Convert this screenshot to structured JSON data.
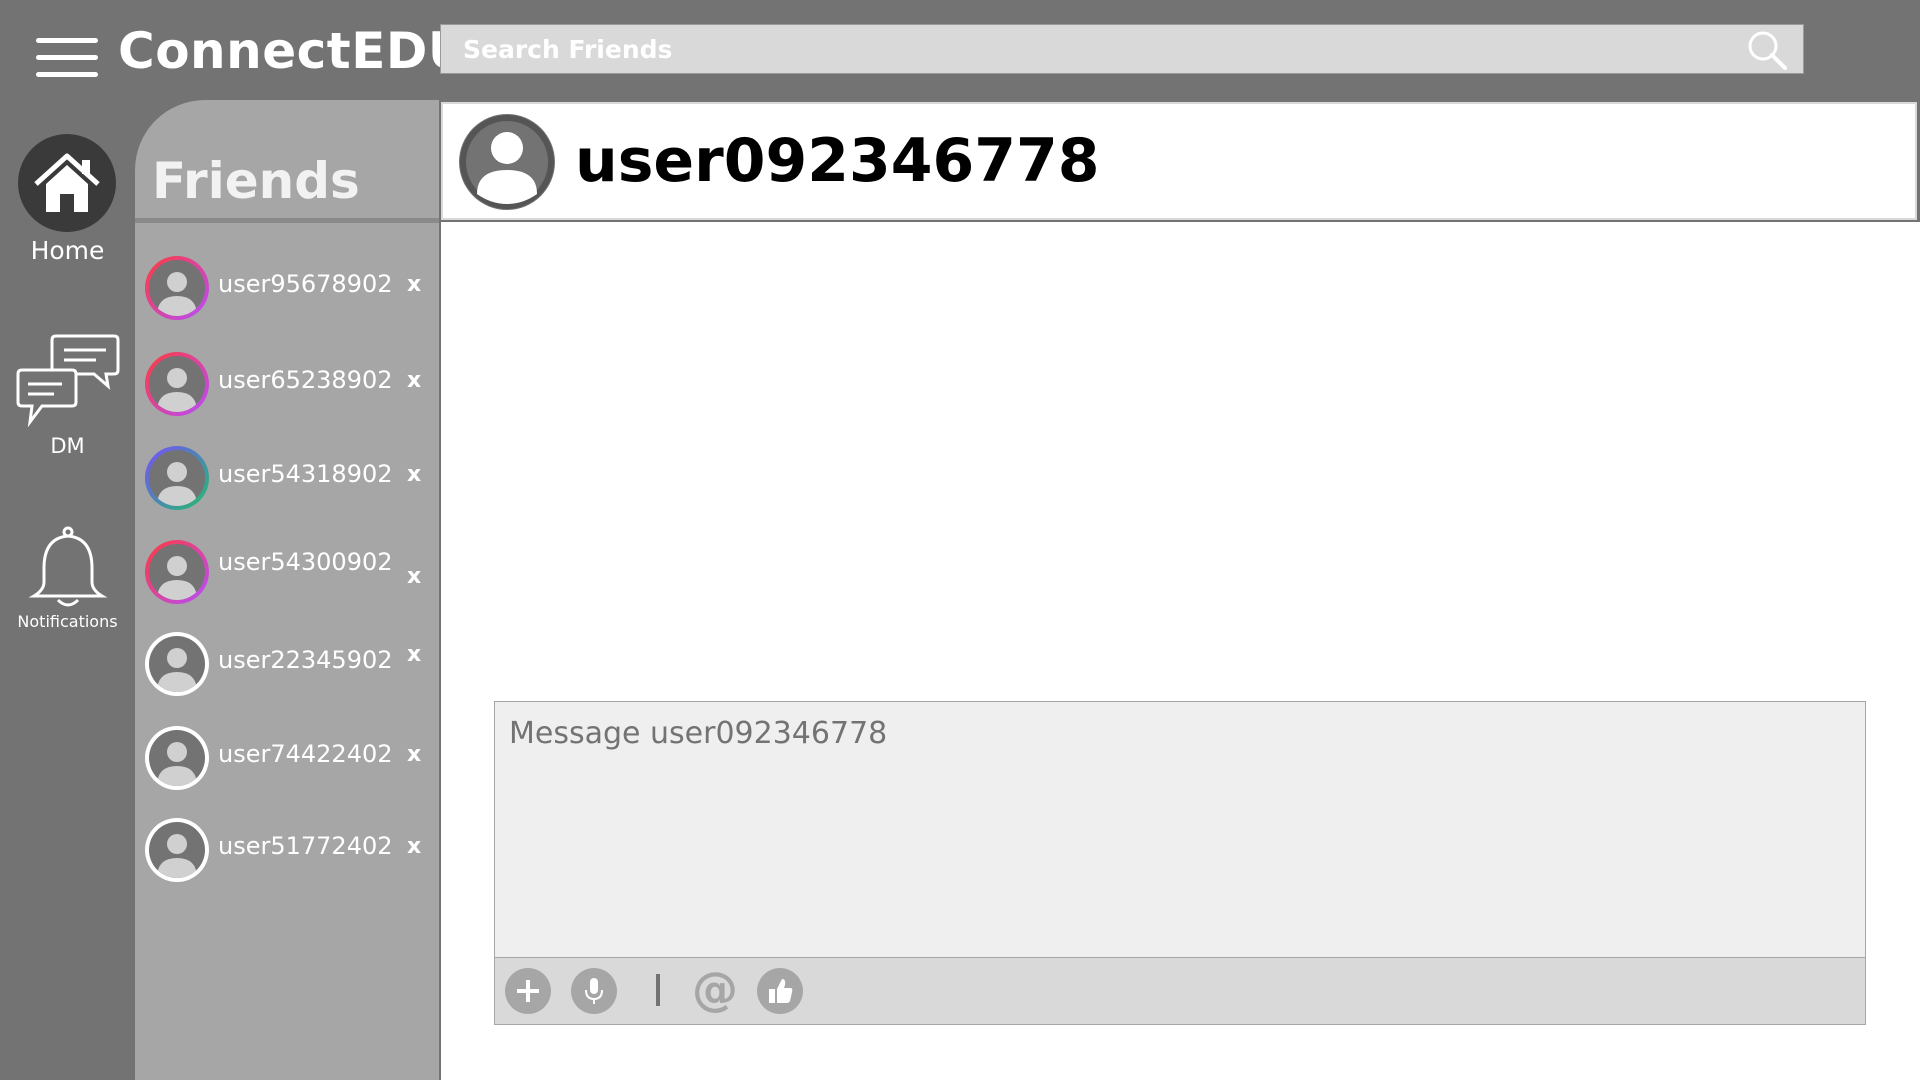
{
  "app": {
    "title": "ConnectEDU"
  },
  "search": {
    "placeholder": "Search Friends"
  },
  "nav": {
    "home_label": "Home",
    "dm_label": "DM",
    "notifications_label": "Notifications"
  },
  "friends": {
    "title": "Friends",
    "remove_label": "x",
    "items": [
      {
        "name": "user95678902",
        "ring": "gradient-pink-purple"
      },
      {
        "name": "user65238902",
        "ring": "gradient-pink-purple"
      },
      {
        "name": "user54318902",
        "ring": "gradient-purple-green"
      },
      {
        "name": "user54300902",
        "ring": "gradient-pink-purple"
      },
      {
        "name": "user22345902",
        "ring": "white"
      },
      {
        "name": "user74422402",
        "ring": "white"
      },
      {
        "name": "user51772402",
        "ring": "white"
      }
    ]
  },
  "chat": {
    "username": "user092346778",
    "message_placeholder": "Message user092346778"
  },
  "toolbar": {
    "add_icon": "plus-icon",
    "mic_icon": "microphone-icon",
    "mention_label": "@",
    "like_icon": "thumbs-up-icon"
  },
  "colors": {
    "background": "#737373",
    "panel": "#a6a6a6",
    "light": "#d9d9d9",
    "compose": "#efefef"
  }
}
